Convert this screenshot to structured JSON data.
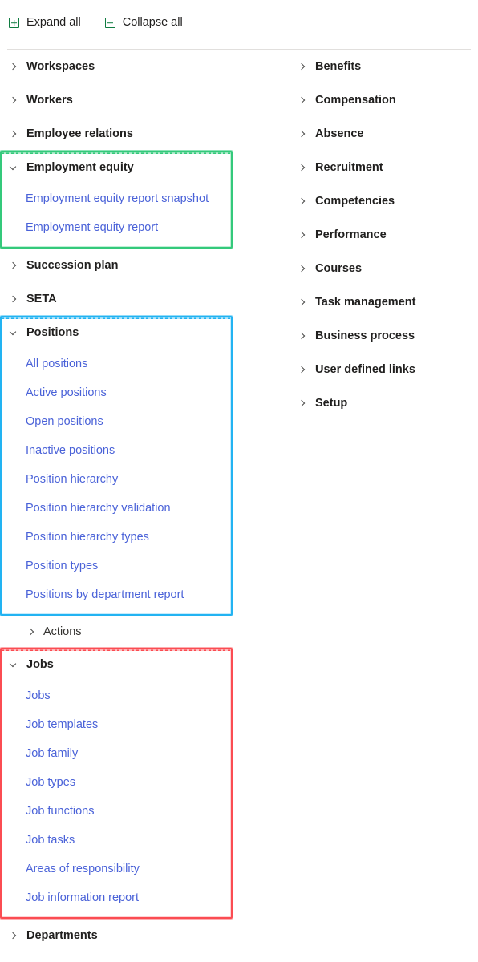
{
  "toolbar": {
    "expand_all": "Expand all",
    "collapse_all": "Collapse all",
    "expand_icon": "expand-all-plus-box-icon",
    "collapse_icon": "collapse-all-minus-box-icon"
  },
  "colors": {
    "link": "#4a62d8",
    "label": "#201f1e",
    "icon_green": "#107c41",
    "highlight_green": "#34c97b",
    "highlight_blue": "#22b3f2",
    "highlight_red": "#fb4c52",
    "divider": "#e1dfdd"
  },
  "left_column": {
    "groups": [
      {
        "label": "Workspaces",
        "state": "collapsed",
        "highlight": "none",
        "items": []
      },
      {
        "label": "Workers",
        "state": "collapsed",
        "highlight": "none",
        "items": []
      },
      {
        "label": "Employee relations",
        "state": "collapsed",
        "highlight": "none",
        "items": []
      },
      {
        "label": "Employment equity",
        "state": "expanded",
        "highlight": "green",
        "items": [
          "Employment equity report snapshot",
          "Employment equity report"
        ]
      },
      {
        "label": "Succession plan",
        "state": "collapsed",
        "highlight": "none",
        "items": []
      },
      {
        "label": "SETA",
        "state": "collapsed",
        "highlight": "none",
        "items": []
      },
      {
        "label": "Positions",
        "state": "expanded",
        "highlight": "blue",
        "items": [
          "All positions",
          "Active positions",
          "Open positions",
          "Inactive positions",
          "Position hierarchy",
          "Position hierarchy validation",
          "Position hierarchy types",
          "Position types",
          "Positions by department report"
        ]
      },
      {
        "label": "Actions",
        "state": "collapsed",
        "highlight": "none",
        "nested": true,
        "items": []
      },
      {
        "label": "Jobs",
        "state": "expanded",
        "highlight": "red",
        "items": [
          "Jobs",
          "Job templates",
          "Job family",
          "Job types",
          "Job functions",
          "Job tasks",
          "Areas of responsibility",
          "Job information report"
        ]
      },
      {
        "label": "Departments",
        "state": "collapsed",
        "highlight": "none",
        "items": []
      }
    ]
  },
  "right_column": {
    "groups": [
      {
        "label": "Benefits",
        "state": "collapsed"
      },
      {
        "label": "Compensation",
        "state": "collapsed"
      },
      {
        "label": "Absence",
        "state": "collapsed"
      },
      {
        "label": "Recruitment",
        "state": "collapsed"
      },
      {
        "label": "Competencies",
        "state": "collapsed"
      },
      {
        "label": "Performance",
        "state": "collapsed"
      },
      {
        "label": "Courses",
        "state": "collapsed"
      },
      {
        "label": "Task management",
        "state": "collapsed"
      },
      {
        "label": "Business process",
        "state": "collapsed"
      },
      {
        "label": "User defined links",
        "state": "collapsed"
      },
      {
        "label": "Setup",
        "state": "collapsed"
      }
    ]
  }
}
